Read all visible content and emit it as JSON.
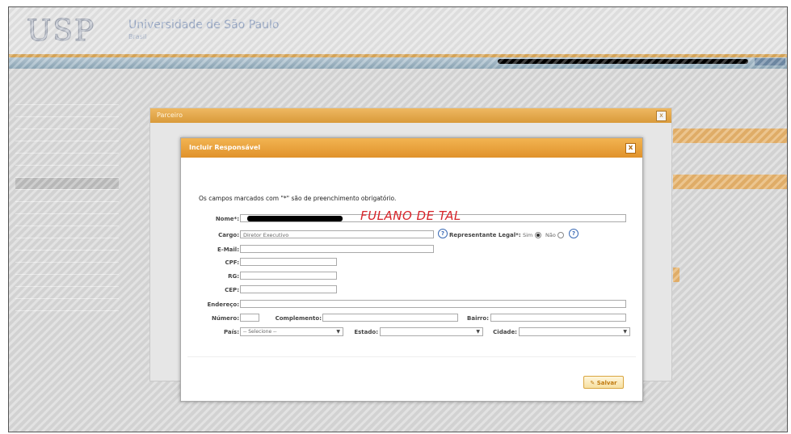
{
  "header": {
    "logo_text": "USP",
    "university_name": "Universidade de São Paulo",
    "university_sub": "Brasil"
  },
  "outer_dialog": {
    "title": "Parceiro",
    "close_label": "x"
  },
  "dialog": {
    "title": "Incluir Responsável",
    "close_label": "x",
    "required_note": "Os campos marcados com \"*\" são de preenchimento obrigatório.",
    "handwritten_name": "FULANO DE TAL",
    "fields": {
      "nome_label": "Nome*:",
      "cargo_label": "Cargo:",
      "cargo_value": "Diretor Executivo",
      "email_label": "E-Mail:",
      "cpf_label": "CPF:",
      "rg_label": "RG:",
      "cep_label": "CEP:",
      "endereco_label": "Endereço:",
      "numero_label": "Número:",
      "complemento_label": "Complemento:",
      "bairro_label": "Bairro:",
      "pais_label": "País:",
      "pais_value": "-- Selecione --",
      "estado_label": "Estado:",
      "cidade_label": "Cidade:",
      "representante_label": "Representante Legal*:",
      "sim_label": "Sim",
      "nao_label": "Não"
    },
    "representante_selected": "Sim",
    "save_label": "Salvar",
    "help_icon": "?"
  },
  "accent_colors": {
    "dialog_title": "#e8a33a",
    "outer_title": "#e6a84c",
    "annotation_red": "#d8242a"
  }
}
